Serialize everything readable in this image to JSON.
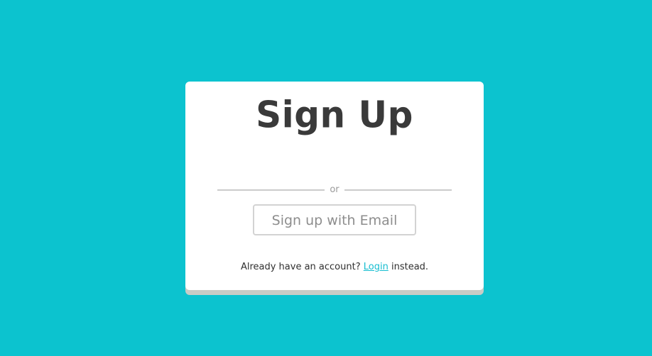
{
  "signup": {
    "title": "Sign Up",
    "divider_text": "or",
    "email_button_label": "Sign up with Email",
    "footer_prefix": "Already have an account?",
    "login_link_text": "Login",
    "footer_suffix": "instead."
  },
  "colors": {
    "background": "#0cc3cf",
    "card": "#ffffff",
    "title": "#3a3a3a",
    "accent": "#15bdd0"
  }
}
